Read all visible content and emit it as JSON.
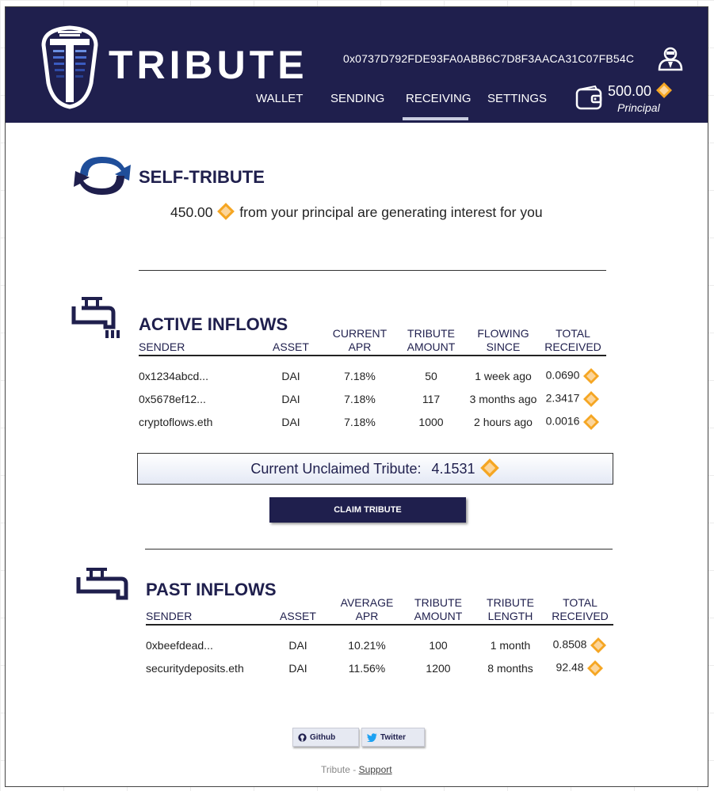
{
  "header": {
    "brand": "TRIBUTE",
    "address": "0x0737D792FDE93FA0ABB6C7D8F3AACA31C07FB54C",
    "nav": {
      "wallet": "WALLET",
      "sending": "SENDING",
      "receiving": "RECEIVING",
      "settings": "SETTINGS",
      "active": "RECEIVING"
    },
    "principal_amount": "500.00",
    "principal_label": "Principal"
  },
  "self_tribute": {
    "title": "SELF-TRIBUTE",
    "amount": "450.00",
    "text": "from your principal are generating interest for you"
  },
  "active_inflows": {
    "title": "ACTIVE INFLOWS",
    "columns": {
      "sender": "SENDER",
      "asset": "ASSET",
      "apr_1": "CURRENT",
      "apr_2": "APR",
      "amount_1": "TRIBUTE",
      "amount_2": "AMOUNT",
      "since_1": "FLOWING",
      "since_2": "SINCE",
      "total_1": "TOTAL",
      "total_2": "RECEIVED"
    },
    "rows": [
      {
        "sender": "0x1234abcd...",
        "asset": "DAI",
        "apr": "7.18%",
        "amount": "50",
        "since": "1 week ago",
        "total": "0.0690"
      },
      {
        "sender": "0x5678ef12...",
        "asset": "DAI",
        "apr": "7.18%",
        "amount": "117",
        "since": "3 months ago",
        "total": "2.3417"
      },
      {
        "sender": "cryptoflows.eth",
        "asset": "DAI",
        "apr": "7.18%",
        "amount": "1000",
        "since": "2 hours ago",
        "total": "0.0016"
      }
    ]
  },
  "unclaimed": {
    "label": "Current Unclaimed Tribute:",
    "value": "4.1531"
  },
  "claim_button": "CLAIM TRIBUTE",
  "past_inflows": {
    "title": "PAST INFLOWS",
    "columns": {
      "sender": "SENDER",
      "asset": "ASSET",
      "apr_1": "AVERAGE",
      "apr_2": "APR",
      "amount_1": "TRIBUTE",
      "amount_2": "AMOUNT",
      "length_1": "TRIBUTE",
      "length_2": "LENGTH",
      "total_1": "TOTAL",
      "total_2": "RECEIVED"
    },
    "rows": [
      {
        "sender": "0xbeefdead...",
        "asset": "DAI",
        "apr": "10.21%",
        "amount": "100",
        "length": "1 month",
        "total": "0.8508"
      },
      {
        "sender": "securitydeposits.eth",
        "asset": "DAI",
        "apr": "11.56%",
        "amount": "1200",
        "length": "8 months",
        "total": "92.48"
      }
    ]
  },
  "footer": {
    "github": "Github",
    "twitter": "Twitter",
    "text": "Tribute - ",
    "support": "Support"
  },
  "colors": {
    "navy": "#1f1f4d",
    "coin_outer": "#f5a623",
    "coin_inner": "#fcd59a"
  },
  "icons": [
    "tribute-logo",
    "user-icon",
    "wallet-icon",
    "dai-coin-icon",
    "refresh-arrows-icon",
    "faucet-icon",
    "github-icon",
    "twitter-icon"
  ]
}
